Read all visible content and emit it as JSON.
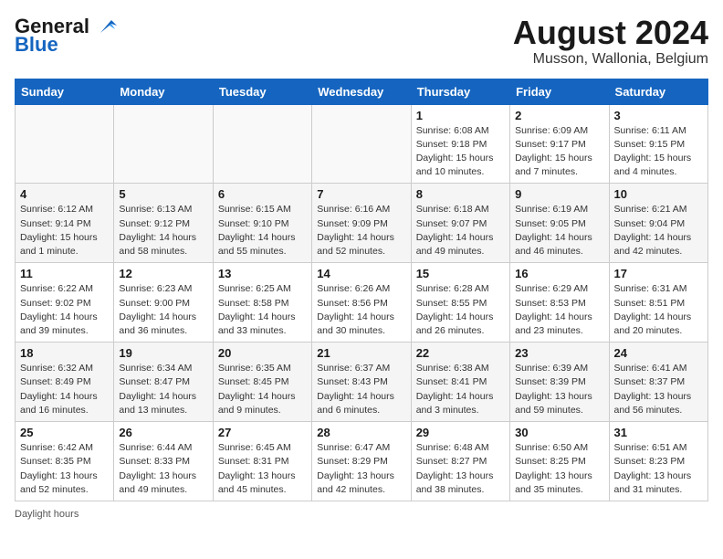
{
  "header": {
    "logo_general": "General",
    "logo_blue": "Blue",
    "month_year": "August 2024",
    "location": "Musson, Wallonia, Belgium"
  },
  "days_of_week": [
    "Sunday",
    "Monday",
    "Tuesday",
    "Wednesday",
    "Thursday",
    "Friday",
    "Saturday"
  ],
  "weeks": [
    [
      {
        "day": "",
        "info": ""
      },
      {
        "day": "",
        "info": ""
      },
      {
        "day": "",
        "info": ""
      },
      {
        "day": "",
        "info": ""
      },
      {
        "day": "1",
        "info": "Sunrise: 6:08 AM\nSunset: 9:18 PM\nDaylight: 15 hours\nand 10 minutes."
      },
      {
        "day": "2",
        "info": "Sunrise: 6:09 AM\nSunset: 9:17 PM\nDaylight: 15 hours\nand 7 minutes."
      },
      {
        "day": "3",
        "info": "Sunrise: 6:11 AM\nSunset: 9:15 PM\nDaylight: 15 hours\nand 4 minutes."
      }
    ],
    [
      {
        "day": "4",
        "info": "Sunrise: 6:12 AM\nSunset: 9:14 PM\nDaylight: 15 hours\nand 1 minute."
      },
      {
        "day": "5",
        "info": "Sunrise: 6:13 AM\nSunset: 9:12 PM\nDaylight: 14 hours\nand 58 minutes."
      },
      {
        "day": "6",
        "info": "Sunrise: 6:15 AM\nSunset: 9:10 PM\nDaylight: 14 hours\nand 55 minutes."
      },
      {
        "day": "7",
        "info": "Sunrise: 6:16 AM\nSunset: 9:09 PM\nDaylight: 14 hours\nand 52 minutes."
      },
      {
        "day": "8",
        "info": "Sunrise: 6:18 AM\nSunset: 9:07 PM\nDaylight: 14 hours\nand 49 minutes."
      },
      {
        "day": "9",
        "info": "Sunrise: 6:19 AM\nSunset: 9:05 PM\nDaylight: 14 hours\nand 46 minutes."
      },
      {
        "day": "10",
        "info": "Sunrise: 6:21 AM\nSunset: 9:04 PM\nDaylight: 14 hours\nand 42 minutes."
      }
    ],
    [
      {
        "day": "11",
        "info": "Sunrise: 6:22 AM\nSunset: 9:02 PM\nDaylight: 14 hours\nand 39 minutes."
      },
      {
        "day": "12",
        "info": "Sunrise: 6:23 AM\nSunset: 9:00 PM\nDaylight: 14 hours\nand 36 minutes."
      },
      {
        "day": "13",
        "info": "Sunrise: 6:25 AM\nSunset: 8:58 PM\nDaylight: 14 hours\nand 33 minutes."
      },
      {
        "day": "14",
        "info": "Sunrise: 6:26 AM\nSunset: 8:56 PM\nDaylight: 14 hours\nand 30 minutes."
      },
      {
        "day": "15",
        "info": "Sunrise: 6:28 AM\nSunset: 8:55 PM\nDaylight: 14 hours\nand 26 minutes."
      },
      {
        "day": "16",
        "info": "Sunrise: 6:29 AM\nSunset: 8:53 PM\nDaylight: 14 hours\nand 23 minutes."
      },
      {
        "day": "17",
        "info": "Sunrise: 6:31 AM\nSunset: 8:51 PM\nDaylight: 14 hours\nand 20 minutes."
      }
    ],
    [
      {
        "day": "18",
        "info": "Sunrise: 6:32 AM\nSunset: 8:49 PM\nDaylight: 14 hours\nand 16 minutes."
      },
      {
        "day": "19",
        "info": "Sunrise: 6:34 AM\nSunset: 8:47 PM\nDaylight: 14 hours\nand 13 minutes."
      },
      {
        "day": "20",
        "info": "Sunrise: 6:35 AM\nSunset: 8:45 PM\nDaylight: 14 hours\nand 9 minutes."
      },
      {
        "day": "21",
        "info": "Sunrise: 6:37 AM\nSunset: 8:43 PM\nDaylight: 14 hours\nand 6 minutes."
      },
      {
        "day": "22",
        "info": "Sunrise: 6:38 AM\nSunset: 8:41 PM\nDaylight: 14 hours\nand 3 minutes."
      },
      {
        "day": "23",
        "info": "Sunrise: 6:39 AM\nSunset: 8:39 PM\nDaylight: 13 hours\nand 59 minutes."
      },
      {
        "day": "24",
        "info": "Sunrise: 6:41 AM\nSunset: 8:37 PM\nDaylight: 13 hours\nand 56 minutes."
      }
    ],
    [
      {
        "day": "25",
        "info": "Sunrise: 6:42 AM\nSunset: 8:35 PM\nDaylight: 13 hours\nand 52 minutes."
      },
      {
        "day": "26",
        "info": "Sunrise: 6:44 AM\nSunset: 8:33 PM\nDaylight: 13 hours\nand 49 minutes."
      },
      {
        "day": "27",
        "info": "Sunrise: 6:45 AM\nSunset: 8:31 PM\nDaylight: 13 hours\nand 45 minutes."
      },
      {
        "day": "28",
        "info": "Sunrise: 6:47 AM\nSunset: 8:29 PM\nDaylight: 13 hours\nand 42 minutes."
      },
      {
        "day": "29",
        "info": "Sunrise: 6:48 AM\nSunset: 8:27 PM\nDaylight: 13 hours\nand 38 minutes."
      },
      {
        "day": "30",
        "info": "Sunrise: 6:50 AM\nSunset: 8:25 PM\nDaylight: 13 hours\nand 35 minutes."
      },
      {
        "day": "31",
        "info": "Sunrise: 6:51 AM\nSunset: 8:23 PM\nDaylight: 13 hours\nand 31 minutes."
      }
    ]
  ],
  "footer": {
    "note": "Daylight hours"
  }
}
